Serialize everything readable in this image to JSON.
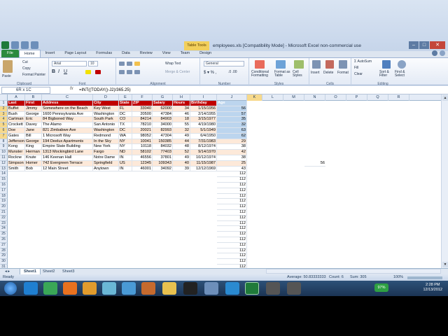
{
  "window": {
    "title": "employees.xls  [Compatibility Mode]  -  Microsoft Excel non-commercial use",
    "table_tools": "Table Tools"
  },
  "tabs": [
    "File",
    "Home",
    "Insert",
    "Page Layout",
    "Formulas",
    "Data",
    "Review",
    "View",
    "Team",
    "Design"
  ],
  "ribbon": {
    "clipboard": {
      "label": "Clipboard",
      "paste": "Paste",
      "cut": "Cut",
      "copy": "Copy",
      "format_painter": "Format Painter"
    },
    "font": {
      "label": "Font",
      "name": "Arial",
      "size": "10"
    },
    "alignment": {
      "label": "Alignment",
      "wrap": "Wrap Text",
      "merge": "Merge & Center"
    },
    "number": {
      "label": "Number",
      "format": "General"
    },
    "styles": {
      "label": "Styles",
      "cond": "Conditional Formatting",
      "table": "Format as Table",
      "cell": "Cell Styles"
    },
    "cells": {
      "label": "Cells",
      "insert": "Insert",
      "delete": "Delete",
      "format": "Format"
    },
    "editing": {
      "label": "Editing",
      "autosum": "AutoSum",
      "fill": "Fill",
      "clear": "Clear",
      "sort": "Sort & Filter",
      "find": "Find & Select"
    }
  },
  "formula_bar": {
    "name_box": "6R x 1C",
    "fx": "fx",
    "formula": "=INT((TODAY()-J2)/365.25)"
  },
  "columns": [
    "A",
    "B",
    "C",
    "D",
    "E",
    "F",
    "G",
    "H",
    "I",
    "J",
    "K",
    "L",
    "M",
    "N",
    "O",
    "P",
    "Q",
    "R"
  ],
  "header_row": [
    "Last",
    "First",
    "Address",
    "City",
    "State",
    "ZIP",
    "Salary",
    "Hours",
    "Birthday",
    "Age"
  ],
  "rows": [
    [
      "Buffet",
      "Jimmy",
      "Somewhere on the Beach",
      "Key West",
      "FL",
      "33040",
      "62000",
      "34",
      "1/15/1956",
      "56"
    ],
    [
      "Bush",
      "George",
      "1600 Pennsylvania Ave",
      "Washington",
      "DC",
      "20500",
      "47384",
      "46",
      "2/14/1955",
      "57"
    ],
    [
      "Cartman",
      "Eric",
      "84 Bigboned Way",
      "South Park",
      "CO",
      "84214",
      "84903",
      "18",
      "3/15/1977",
      "35"
    ],
    [
      "Crockett",
      "Davey",
      "The Alamo",
      "San Antonio",
      "TX",
      "78210",
      "34000",
      "55",
      "4/19/1980",
      "32"
    ],
    [
      "Doe",
      "Jane",
      "821 Zimbabwe Ave",
      "Washington",
      "DC",
      "20021",
      "82993",
      "32",
      "5/1/1949",
      "63"
    ],
    [
      "Gates",
      "Bill",
      "1 Microsoft Way",
      "Redmond",
      "WA",
      "98052",
      "47304",
      "49",
      "6/4/1950",
      "62"
    ],
    [
      "Jefferson",
      "George",
      "194 Deelux Apartments",
      "In the Sky",
      "NY",
      "10041",
      "150385",
      "44",
      "7/31/1983",
      "29"
    ],
    [
      "Kong",
      "King",
      "Empire State Building",
      "New York",
      "NY",
      "10118",
      "84032",
      "48",
      "8/12/1974",
      "38"
    ],
    [
      "Munster",
      "Herman",
      "1313 Mockingbird Lane",
      "Fargo",
      "ND",
      "58102",
      "77403",
      "52",
      "9/14/1970",
      "42"
    ],
    [
      "Rockne",
      "Knute",
      "146 Keenan Hall",
      "Notre Dame",
      "IN",
      "46556",
      "37801",
      "49",
      "10/12/1974",
      "38"
    ],
    [
      "Simpson",
      "Homer",
      "742 Evergreen Terrace",
      "Springfield",
      "US",
      "12345",
      "109343",
      "40",
      "11/15/1987",
      "25"
    ],
    [
      "Smith",
      "Bob",
      "12 Main Street",
      "Anytown",
      "IN",
      "46001",
      "34092",
      "39",
      "12/12/1969",
      "43"
    ]
  ],
  "stray_value": "56",
  "filler_value": "112",
  "filler_count": 22,
  "sheet_tabs": [
    "Sheet1",
    "Sheet2",
    "Sheet3"
  ],
  "status": {
    "ready": "Ready",
    "average": "Average: 50.83333333",
    "count": "Count: 6",
    "sum": "Sum: 305",
    "zoom": "100%"
  },
  "clock": {
    "time": "2:28 PM",
    "date": "12/13/2012"
  },
  "battery": "97%"
}
